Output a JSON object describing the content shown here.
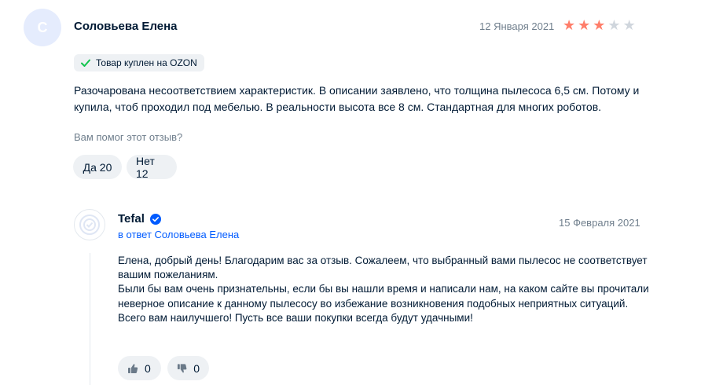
{
  "review": {
    "avatar_letter": "С",
    "author": "Соловьева Елена",
    "date": "12 Января 2021",
    "rating": 3,
    "rating_max": 5,
    "badge_text": "Товар куплен на OZON",
    "text": "Разочарована несоответствием характеристик. В описании заявлено, что толщина пылесоса 6,5 см. Потому и купила, чтоб проходил под мебелью. В реальности высота все 8 см. Стандартная для многих роботов.",
    "helpful_question": "Вам помог этот отзыв?",
    "yes_label": "Да 20",
    "no_label": "Нет 12"
  },
  "reply": {
    "author": "Tefal",
    "reply_to": "в ответ Соловьева Елена",
    "date": "15 Февраля 2021",
    "paragraphs": [
      "Елена, добрый день! Благодарим вас за отзыв. Сожалеем, что выбранный вами пылесос не соответствует вашим пожеланиям.",
      "Были бы вам очень признательны, если бы вы нашли время и написали нам, на каком сайте вы прочитали неверное описание к данному пылесосу во избежание возникновения подобных неприятных ситуаций.",
      "Всего вам наилучшего! Пусть все ваши покупки всегда будут удачными!"
    ],
    "likes": "0",
    "dislikes": "0"
  },
  "colors": {
    "star_on": "#ff7e6a",
    "star_off": "#d0d6dd",
    "link": "#005bff",
    "verified": "#005bff",
    "check": "#10c44c",
    "muted": "#707f8d",
    "chip_bg": "#eef1f4"
  },
  "icons": [
    "check-icon",
    "verified-icon",
    "thumb-up-icon",
    "thumb-down-icon",
    "brand-logo-icon"
  ]
}
